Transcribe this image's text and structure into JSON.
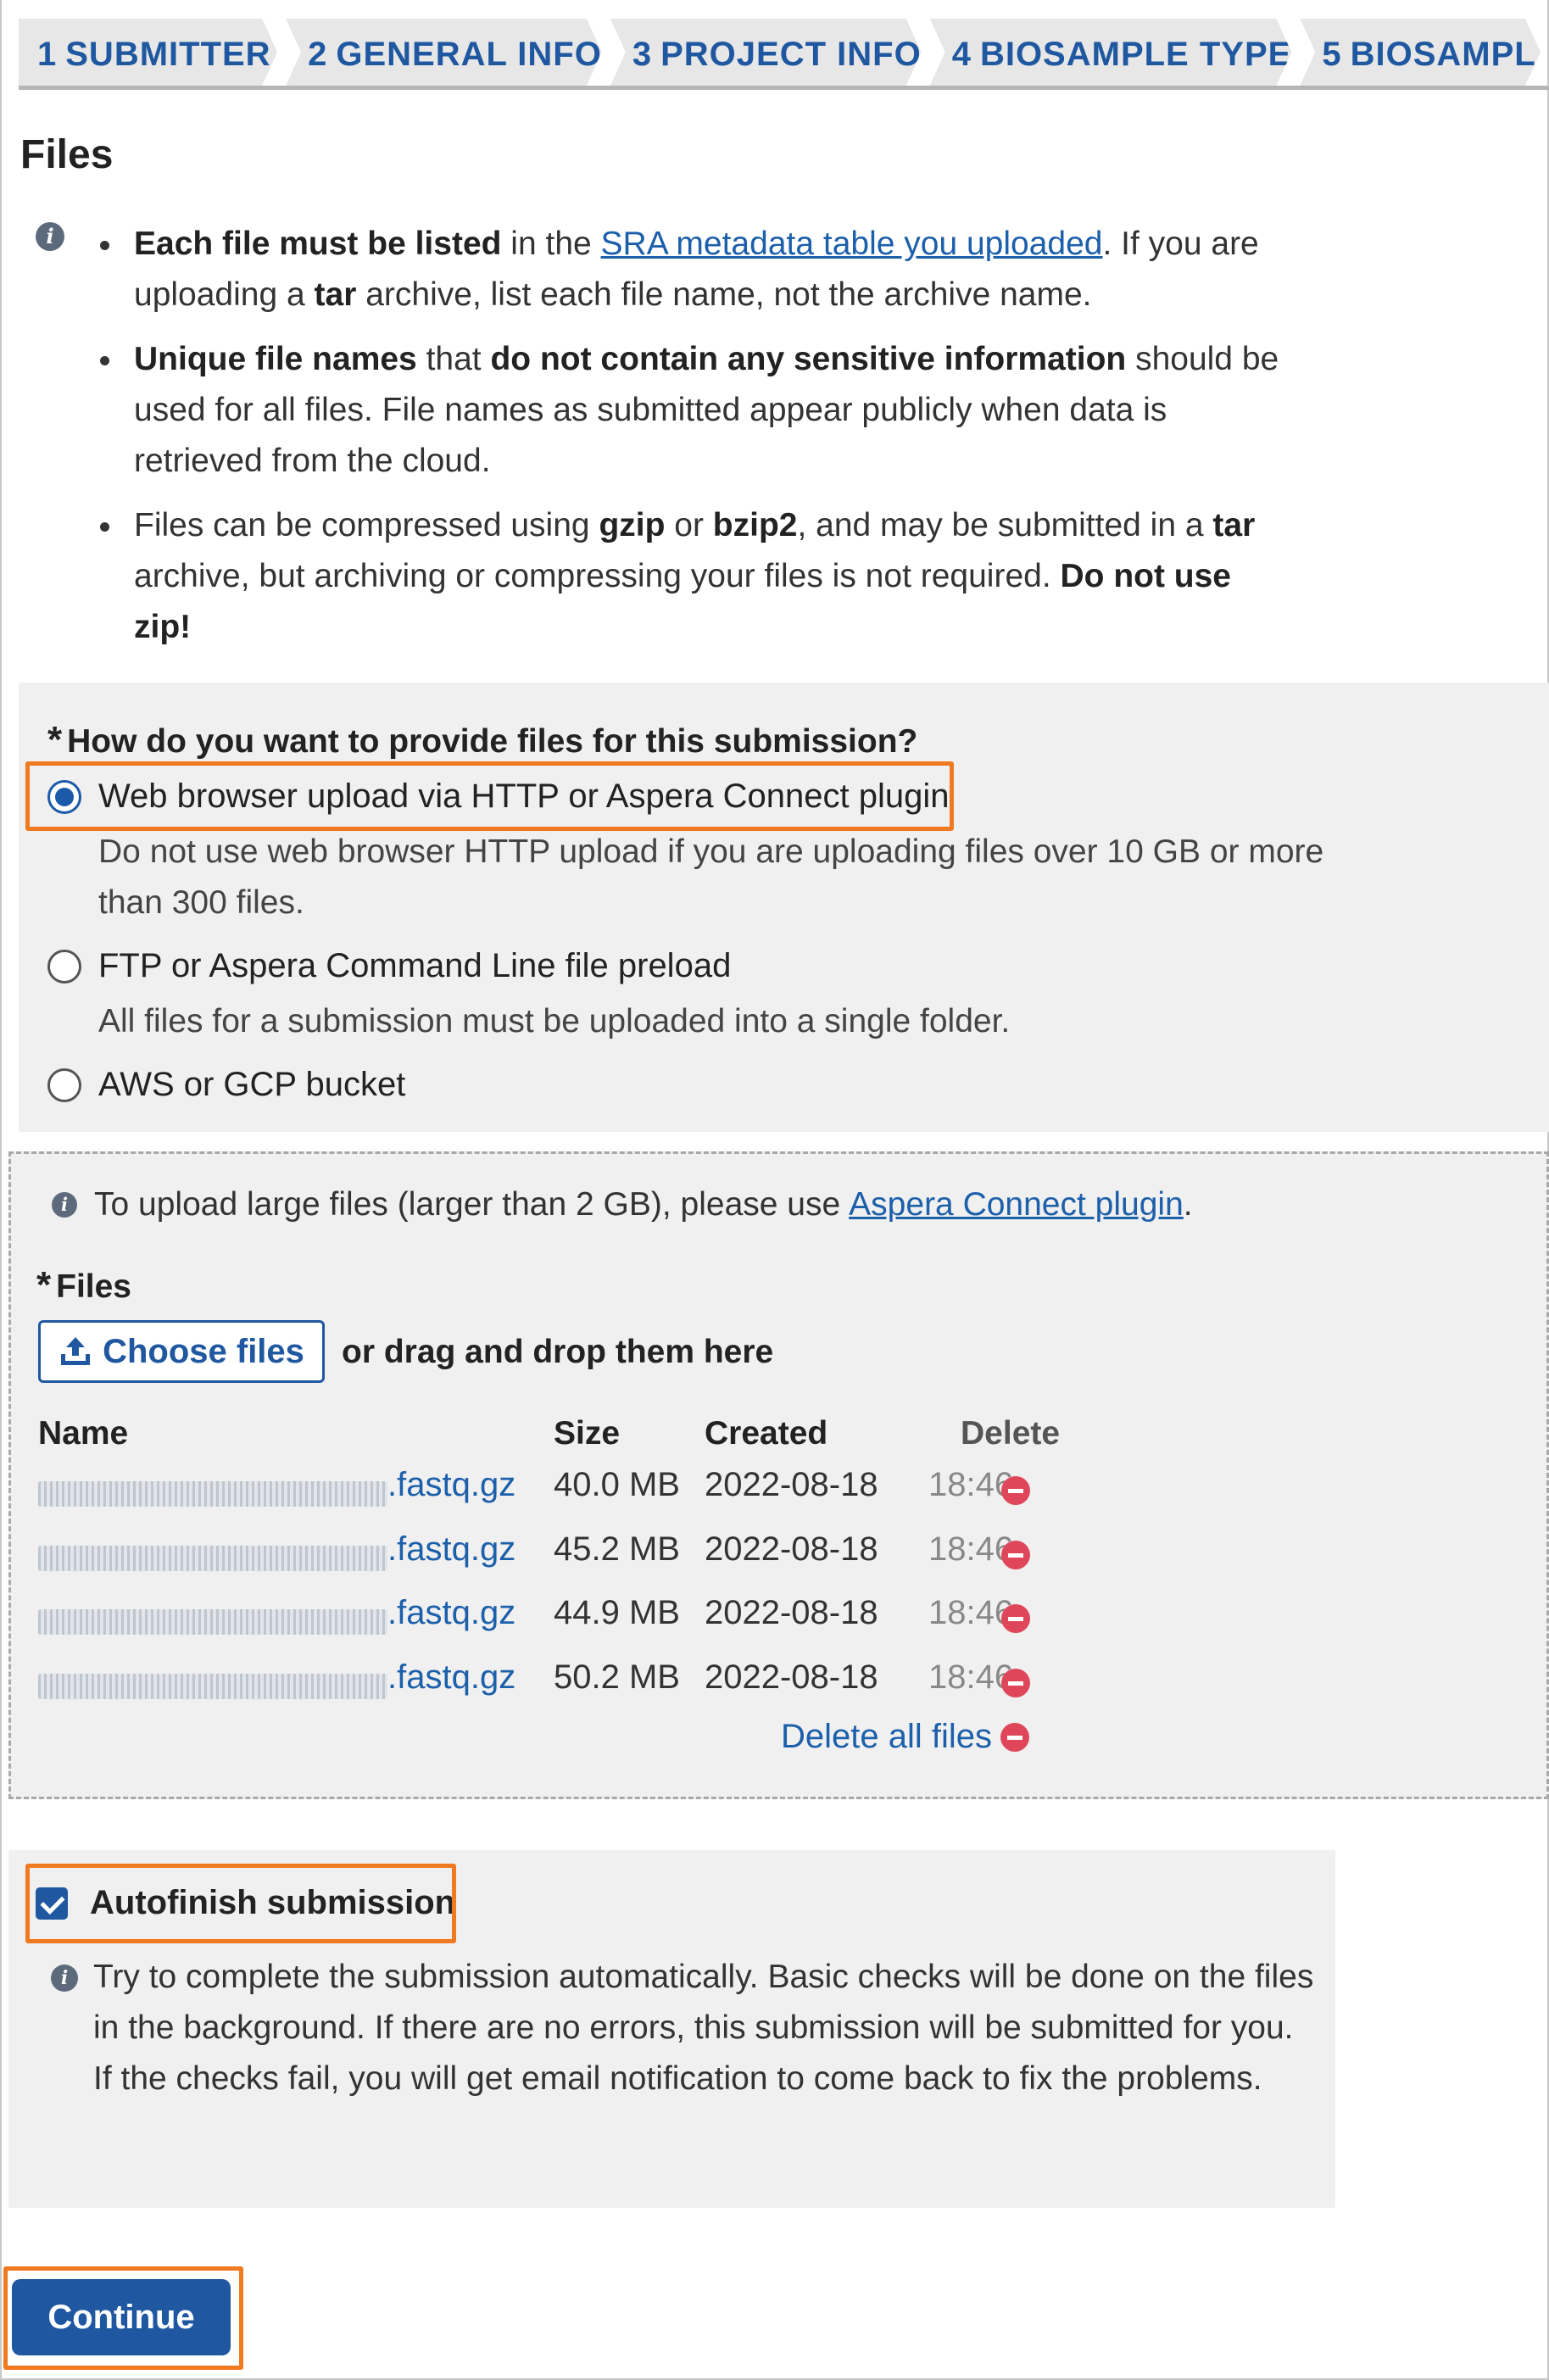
{
  "steps": [
    {
      "num": "1",
      "label": "SUBMITTER"
    },
    {
      "num": "2",
      "label": "GENERAL INFO"
    },
    {
      "num": "3",
      "label": "PROJECT INFO"
    },
    {
      "num": "4",
      "label": "BIOSAMPLE TYPE"
    },
    {
      "num": "5",
      "label": "BIOSAMPL"
    }
  ],
  "page_title": "Files",
  "notes": {
    "n1": {
      "b1": "Each file must be listed",
      "t1": " in the ",
      "link": "SRA metadata table you uploaded",
      "t2": ". If you are uploading a ",
      "b2": "tar",
      "t3": " archive, list each file name, not the archive name."
    },
    "n2": {
      "b1": "Unique file names",
      "t1": " that ",
      "b2": "do not contain any sensitive information",
      "t2": " should be used for all files. File names as submitted appear publicly when data is retrieved from the cloud."
    },
    "n3": {
      "t1": "Files can be compressed using ",
      "b1": "gzip",
      "t2": " or ",
      "b2": "bzip2",
      "t3": ", and may be submitted in a ",
      "b3": "tar",
      "t4": " archive, but archiving or compressing your files is not required. ",
      "b4": "Do not use zip!"
    }
  },
  "provide": {
    "question": "How do you want to provide files for this submission?",
    "star": "*",
    "options": [
      {
        "label": "Web browser upload via HTTP or Aspera Connect plugin",
        "help": "Do not use web browser HTTP upload if you are uploading files over 10 GB or more than 300 files.",
        "checked": true
      },
      {
        "label": "FTP or Aspera Command Line file preload",
        "help": "All files for a submission must be uploaded into a single folder.",
        "checked": false
      },
      {
        "label": "AWS or GCP bucket",
        "help": "",
        "checked": false
      }
    ]
  },
  "upload": {
    "info_text": "To upload large files (larger than 2 GB), please use ",
    "info_link": "Aspera Connect plugin",
    "info_end": ".",
    "files_label": "Files",
    "choose_label": "Choose files",
    "drag_text": "or drag and drop them here",
    "headers": {
      "name": "Name",
      "size": "Size",
      "created": "Created",
      "delete": "Delete"
    },
    "rows": [
      {
        "ext": ".fastq.gz",
        "size": "40.0 MB",
        "date": "2022-08-18",
        "time": "18:46"
      },
      {
        "ext": ".fastq.gz",
        "size": "45.2 MB",
        "date": "2022-08-18",
        "time": "18:46"
      },
      {
        "ext": ".fastq.gz",
        "size": "44.9 MB",
        "date": "2022-08-18",
        "time": "18:46"
      },
      {
        "ext": ".fastq.gz",
        "size": "50.2 MB",
        "date": "2022-08-18",
        "time": "18:46"
      }
    ],
    "delete_all": "Delete all files"
  },
  "autofinish": {
    "label": "Autofinish submission",
    "checked": true,
    "help": "Try to complete the submission automatically. Basic checks will be done on the files in the background. If there are no errors, this submission will be submitted for you. If the checks fail, you will get email notification to come back to fix the problems."
  },
  "continue_label": "Continue",
  "colors": {
    "accent": "#1f58a0",
    "highlight": "#f07a1f",
    "delete": "#e0465a",
    "panel": "#f0f0f0"
  }
}
